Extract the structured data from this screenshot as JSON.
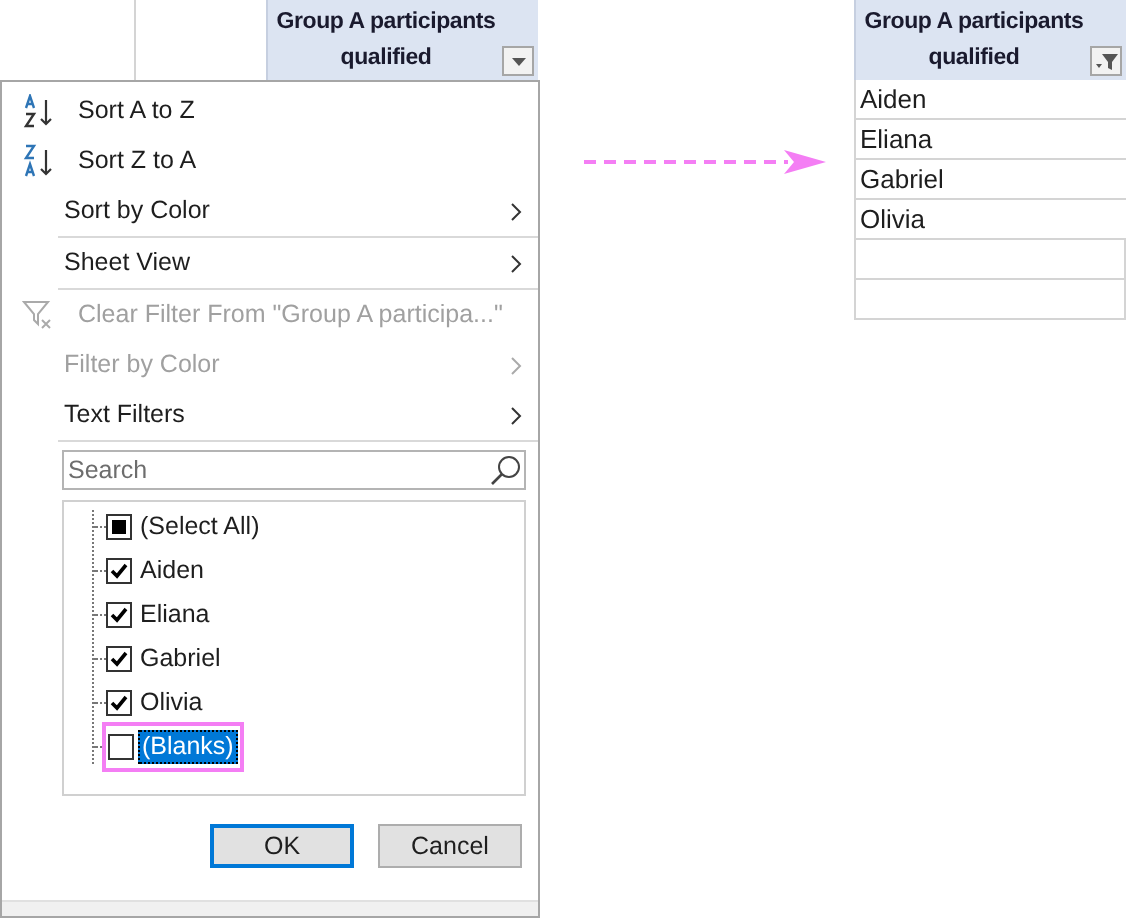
{
  "left_sheet": {
    "header": {
      "title": "Group A participants qualified",
      "filtered": false
    }
  },
  "menu": {
    "items": [
      {
        "kind": "sort-asc",
        "label": "Sort A to Z",
        "disabled": false,
        "divider_after": false
      },
      {
        "kind": "sort-desc",
        "label": "Sort Z to A",
        "disabled": false,
        "divider_after": false
      },
      {
        "kind": "submenu",
        "label": "Sort by Color",
        "disabled": false,
        "divider_after": true
      },
      {
        "kind": "submenu",
        "label": "Sheet View",
        "disabled": false,
        "divider_after": true
      },
      {
        "kind": "clear",
        "label": "Clear Filter From \"Group A participa...\"",
        "disabled": true,
        "divider_after": false
      },
      {
        "kind": "submenu",
        "label": "Filter by Color",
        "disabled": true,
        "divider_after": false
      },
      {
        "kind": "submenu",
        "label": "Text Filters",
        "disabled": false,
        "divider_after": true
      }
    ],
    "search": {
      "placeholder": "Search"
    },
    "values": [
      {
        "kind": "select-all",
        "label": "(Select All)",
        "indeterminate": true,
        "selected": false,
        "highlighted": false
      },
      {
        "kind": "value",
        "label": "Aiden",
        "checked": true,
        "selected": false,
        "highlighted": false
      },
      {
        "kind": "value",
        "label": "Eliana",
        "checked": true,
        "selected": false,
        "highlighted": false
      },
      {
        "kind": "value",
        "label": "Gabriel",
        "checked": true,
        "selected": false,
        "highlighted": false
      },
      {
        "kind": "value",
        "label": "Olivia",
        "checked": true,
        "selected": false,
        "highlighted": false
      },
      {
        "kind": "value",
        "label": "(Blanks)",
        "checked": false,
        "selected": true,
        "highlighted": true
      }
    ],
    "buttons": [
      {
        "label": "OK",
        "default": true
      },
      {
        "label": "Cancel",
        "default": false
      }
    ]
  },
  "right_sheet": {
    "header": {
      "title": "Group A participants qualified",
      "filtered": true
    },
    "rows": [
      "Aiden",
      "Eliana",
      "Gabriel",
      "Olivia"
    ]
  }
}
